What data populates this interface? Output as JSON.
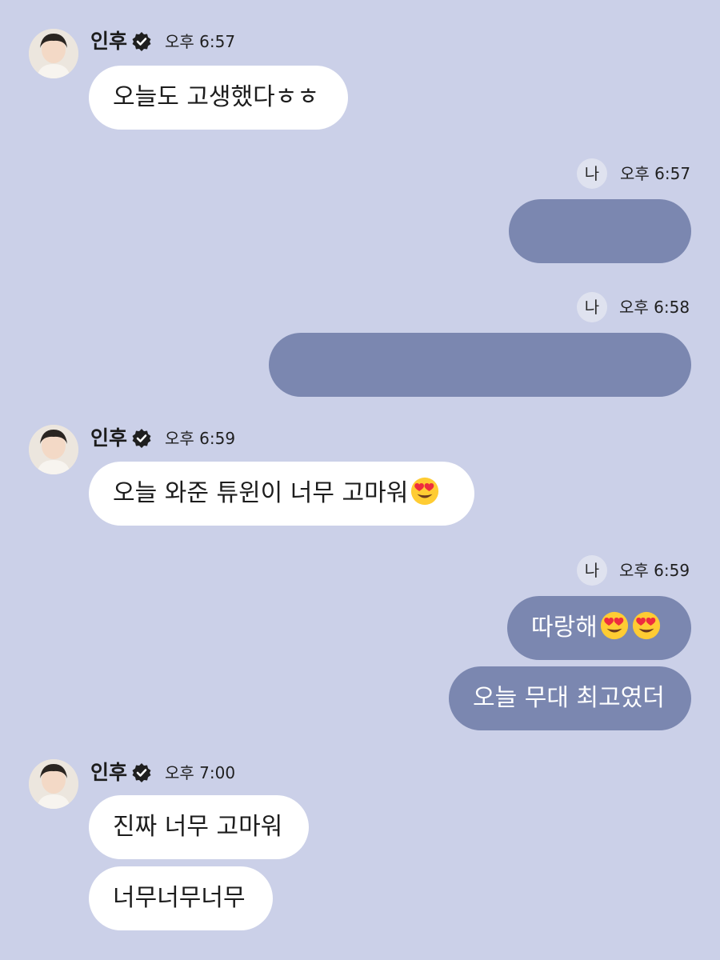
{
  "messages": [
    {
      "sender": "인후",
      "time": "오후 6:57",
      "bubbles": [
        "오늘도 고생했다ㅎㅎ"
      ]
    },
    {
      "sender_badge": "나",
      "time": "오후 6:57"
    },
    {
      "sender_badge": "나",
      "time": "오후 6:58"
    },
    {
      "sender": "인후",
      "time": "오후 6:59",
      "bubbles": [
        "오늘 와준 튜윈이 너무 고마워"
      ]
    },
    {
      "sender_badge": "나",
      "time": "오후 6:59",
      "bubbles": [
        "따랑해",
        "오늘 무대 최고였더"
      ]
    },
    {
      "sender": "인후",
      "time": "오후 7:00",
      "bubbles": [
        "진짜 너무 고마워",
        "너무너무너무"
      ]
    }
  ],
  "icons": {
    "verified": "verified-check-icon",
    "emoji": "heart-eyes-emoji-icon"
  },
  "colors": {
    "background": "#cbd0e8",
    "incoming_bubble": "#ffffff",
    "outgoing_bubble": "#7b87b0"
  }
}
